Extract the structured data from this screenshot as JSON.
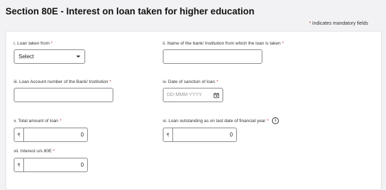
{
  "header": {
    "title": "Section 80E - Interest on loan taken for higher education",
    "mandatory_star": "*",
    "mandatory_note": "Indicates mandatory fields"
  },
  "fields": {
    "loan_taken_from": {
      "label": "i. Loan taken from",
      "required": "*",
      "value": "Select"
    },
    "bank_name": {
      "label": "ii. Name of the bank/ Institution from which the loan is taken",
      "required": "*",
      "value": ""
    },
    "loan_account_number": {
      "label": "iii. Loan Account number of the Bank/ Institution",
      "required": "*",
      "value": ""
    },
    "sanction_date": {
      "label": "iv. Date of sanction of loan",
      "required": "*",
      "placeholder": "DD-MMM-YYYY"
    },
    "total_loan_amount": {
      "label": "v. Total amount of loan",
      "required": "*",
      "currency": "₹",
      "value": "0"
    },
    "loan_outstanding": {
      "label": "vi. Loan outstanding as on last date of financial year",
      "required": "*",
      "currency": "₹",
      "value": "0",
      "info_glyph": "i"
    },
    "interest_80e": {
      "label": "vii. Interest u/s 80E",
      "required": "*",
      "currency": "₹",
      "value": "0"
    }
  },
  "icons": {
    "dropdown": "chevron-down-icon",
    "calendar": "calendar-icon",
    "info": "info-icon"
  }
}
